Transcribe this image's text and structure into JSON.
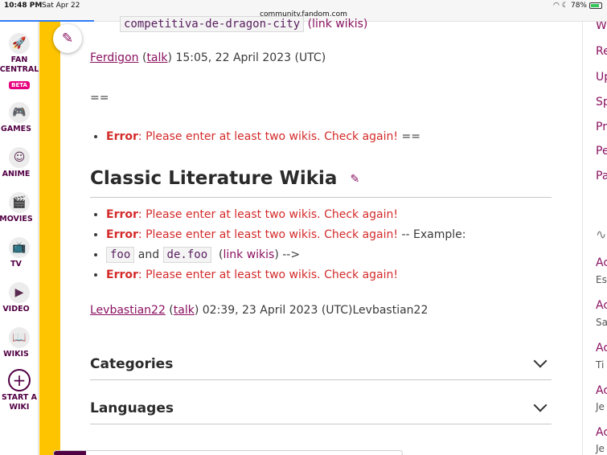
{
  "statusbar": {
    "time": "10:48 PM",
    "date": "Sat Apr 22",
    "url": "community.fandom.com",
    "battery": "78%"
  },
  "rail": {
    "fan_central": "FAN CENTRAL",
    "beta": "BETA",
    "games": "GAMES",
    "anime": "ANIME",
    "movies": "MOVIES",
    "tv": "TV",
    "video": "VIDEO",
    "wikis": "WIKIS",
    "start_a_wiki": "START A WIKI"
  },
  "content": {
    "top_code": "competitiva-de-dragon-city",
    "top_link_text": "(link wikis)",
    "sig1_user": "Ferdigon",
    "sig1_talk": "talk",
    "sig1_time": "15:05, 22 April 2023 (UTC)",
    "equals": "==",
    "error_label": "Error",
    "error_message": ": Please enter at least two wikis. Check again!",
    "error_suffix_eq": " ==",
    "section_title": "Classic Literature Wikia",
    "example_suffix": " -- Example:",
    "code_foo": "foo",
    "and_word": "and",
    "code_defoo": "de.foo",
    "link_wikis": "link wikis",
    "link_tail": ") -->",
    "sig2_user": "Levbastian22",
    "sig2_talk": "talk",
    "sig2_time": " 02:39, 23 April 2023 (UTC)Levbastian22",
    "categories": "Categories",
    "languages": "Languages"
  },
  "right_rail": {
    "items": [
      "Wh",
      "Re",
      "Up",
      "Sp",
      "Pr",
      "Pe",
      "Pa"
    ],
    "activity": [
      {
        "title": "Ac",
        "sub": "Es"
      },
      {
        "title": "Ac",
        "sub": "Sa"
      },
      {
        "title": "Ac",
        "sub": "Ti"
      },
      {
        "title": "Ac",
        "sub": "Je"
      },
      {
        "title": "Ac",
        "sub": "Je"
      }
    ]
  }
}
